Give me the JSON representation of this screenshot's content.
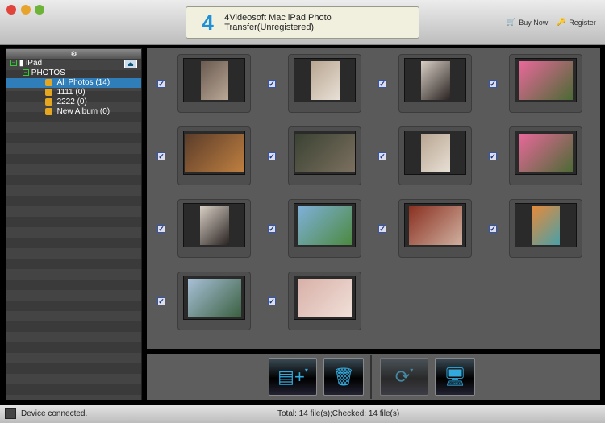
{
  "window": {
    "title": "4Videosoft Mac iPad Photo Transfer(Unregistered)",
    "buy_now": "Buy Now",
    "register": "Register"
  },
  "sidebar": {
    "header_icon": "gear-icon",
    "device": "iPad",
    "group": "PHOTOS",
    "albums": [
      {
        "label": "All Photos (14)",
        "selected": true
      },
      {
        "label": "1111 (0)"
      },
      {
        "label": "2222 (0)"
      },
      {
        "label": "New Album (0)"
      }
    ]
  },
  "photos": [
    {
      "checked": true,
      "colors": [
        "#6a5a50",
        "#b9a896"
      ],
      "portrait": true
    },
    {
      "checked": true,
      "colors": [
        "#b8a590",
        "#e8e0d6"
      ],
      "portrait": false
    },
    {
      "checked": true,
      "colors": [
        "#d8cec4",
        "#2a2422"
      ],
      "portrait": false
    },
    {
      "checked": true,
      "colors": [
        "#e8689a",
        "#4b6b34"
      ],
      "portrait": false
    },
    {
      "checked": true,
      "colors": [
        "#5a3c2a",
        "#c08040"
      ],
      "portrait": false
    },
    {
      "checked": true,
      "colors": [
        "#3a4232",
        "#7c7060"
      ],
      "portrait": false
    },
    {
      "checked": true,
      "colors": [
        "#b8a590",
        "#e8e0d6"
      ],
      "portrait": false
    },
    {
      "checked": true,
      "colors": [
        "#e8689a",
        "#4b6b34"
      ],
      "portrait": false
    },
    {
      "checked": true,
      "colors": [
        "#d8cec4",
        "#2a2422"
      ],
      "portrait": false
    },
    {
      "checked": true,
      "colors": [
        "#7fb0d8",
        "#4c8a40"
      ],
      "portrait": false
    },
    {
      "checked": true,
      "colors": [
        "#8a3020",
        "#d0b0a0"
      ],
      "portrait": false
    },
    {
      "checked": true,
      "colors": [
        "#e68a3a",
        "#4aa0a8"
      ],
      "portrait": true
    },
    {
      "checked": true,
      "colors": [
        "#a8c0d8",
        "#3a6040"
      ],
      "portrait": false
    },
    {
      "checked": true,
      "colors": [
        "#d8b0a8",
        "#f0e0d8"
      ],
      "portrait": false
    }
  ],
  "toolbar": [
    {
      "name": "add-photo-button",
      "icon": "▤+",
      "dropdown": true
    },
    {
      "name": "delete-button",
      "icon": "🗑",
      "dropdown": false
    },
    {
      "name": "transfer-to-device-button",
      "icon": "⟳",
      "dropdown": true,
      "disabled": true
    },
    {
      "name": "export-to-computer-button",
      "icon": "🖥",
      "dropdown": false
    }
  ],
  "status": {
    "left": "Device connected.",
    "center": "Total: 14 file(s);Checked: 14 file(s)"
  }
}
